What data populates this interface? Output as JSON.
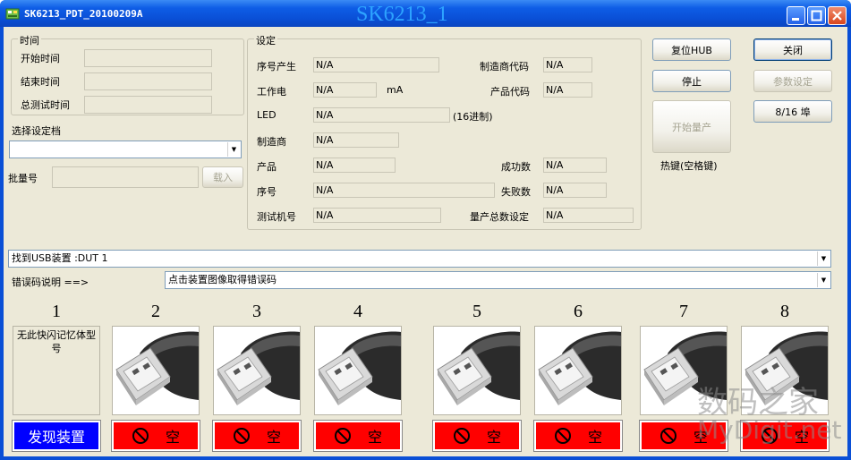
{
  "window": {
    "title": "SK6213_PDT_20100209A",
    "center_title": "SK6213_1"
  },
  "time_group": {
    "title": "时间",
    "start_label": "开始时间",
    "end_label": "结束时间",
    "total_label": "总测试时间",
    "start_value": "",
    "end_value": "",
    "total_value": ""
  },
  "config": {
    "select_label": "选择设定档",
    "select_value": "",
    "batch_label": "批量号",
    "batch_value": "",
    "load_label": "载入"
  },
  "settings": {
    "title": "设定",
    "serial_gen_label": "序号产生",
    "serial_gen_value": "N/A",
    "vendor_code_label": "制造商代码",
    "vendor_code_value": "N/A",
    "current_label": "工作电",
    "current_value": "N/A",
    "current_unit": "mA",
    "product_code_label": "产品代码",
    "product_code_value": "N/A",
    "led_label": "LED",
    "led_value": "N/A",
    "led_hint": "(16进制)",
    "vendor_label": "制造商",
    "vendor_value": "N/A",
    "product_label": "产品",
    "product_value": "N/A",
    "success_label": "成功数",
    "success_value": "N/A",
    "serial_label": "序号",
    "serial_value": "N/A",
    "fail_label": "失败数",
    "fail_value": "N/A",
    "tester_label": "测试机号",
    "tester_value": "N/A",
    "total_set_label": "量产总数设定",
    "total_set_value": "N/A"
  },
  "buttons": {
    "reset_hub": "复位HUB",
    "close": "关闭",
    "stop": "停止",
    "params": "参数设定",
    "start": "开始量产",
    "ports": "8/16 埠",
    "hotkey": "热键(空格键)"
  },
  "device_combo": "找到USB装置 :DUT 1",
  "error": {
    "label": "错误码说明 ==>",
    "value": "点击装置图像取得错误码"
  },
  "slots": [
    {
      "num": "1",
      "text": "无此快闪记忆体型号",
      "status": "发现装置",
      "status_color": "#0000ff"
    },
    {
      "num": "2",
      "status": "空",
      "status_color": "#ff0000"
    },
    {
      "num": "3",
      "status": "空",
      "status_color": "#ff0000"
    },
    {
      "num": "4",
      "status": "空",
      "status_color": "#ff0000"
    },
    {
      "num": "5",
      "status": "空",
      "status_color": "#ff0000"
    },
    {
      "num": "6",
      "status": "空",
      "status_color": "#ff0000"
    },
    {
      "num": "7",
      "status": "空",
      "status_color": "#ff0000"
    },
    {
      "num": "8",
      "status": "空",
      "status_color": "#ff0000"
    }
  ],
  "watermark": {
    "line1": "数码之家",
    "line2": "MyDigit.net"
  }
}
